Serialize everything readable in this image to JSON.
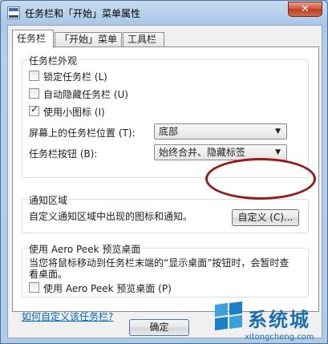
{
  "window": {
    "title": "任务栏和「开始」菜单属性",
    "close_label": "✕"
  },
  "tabs": [
    {
      "label": "任务栏",
      "active": true
    },
    {
      "label": "「开始」菜单",
      "active": false
    },
    {
      "label": "工具栏",
      "active": false
    }
  ],
  "appearance": {
    "title": "任务栏外观",
    "checkboxes": [
      {
        "label": "锁定任务栏 (L)",
        "checked": false
      },
      {
        "label": "自动隐藏任务栏 (U)",
        "checked": false
      },
      {
        "label": "使用小图标 (I)",
        "checked": true
      }
    ],
    "position_label": "屏幕上的任务栏位置 (T):",
    "position_value": "底部",
    "buttons_label": "任务栏按钮 (B):",
    "buttons_value": "始终合并、隐藏标签"
  },
  "notification": {
    "title": "通知区域",
    "description": "自定义通知区域中出现的图标和通知。",
    "customize_button": "自定义 (C)..."
  },
  "peek": {
    "title": "使用 Aero Peek 预览桌面",
    "description": "当您将鼠标移动到任务栏末端的“显示桌面”按钮时，会暂时查看桌面。",
    "checkbox_label": "使用 Aero Peek 预览桌面 (P)",
    "checkbox_checked": false
  },
  "help_link": "如何自定义该任务栏?",
  "footer": {
    "ok_button": "确定"
  },
  "watermark": {
    "name": "系统城",
    "url": "xitongcheng.com"
  },
  "colors": {
    "highlight_oval": "#9a1b1b",
    "link": "#0066cc",
    "watermark": "#1a6fb5"
  }
}
